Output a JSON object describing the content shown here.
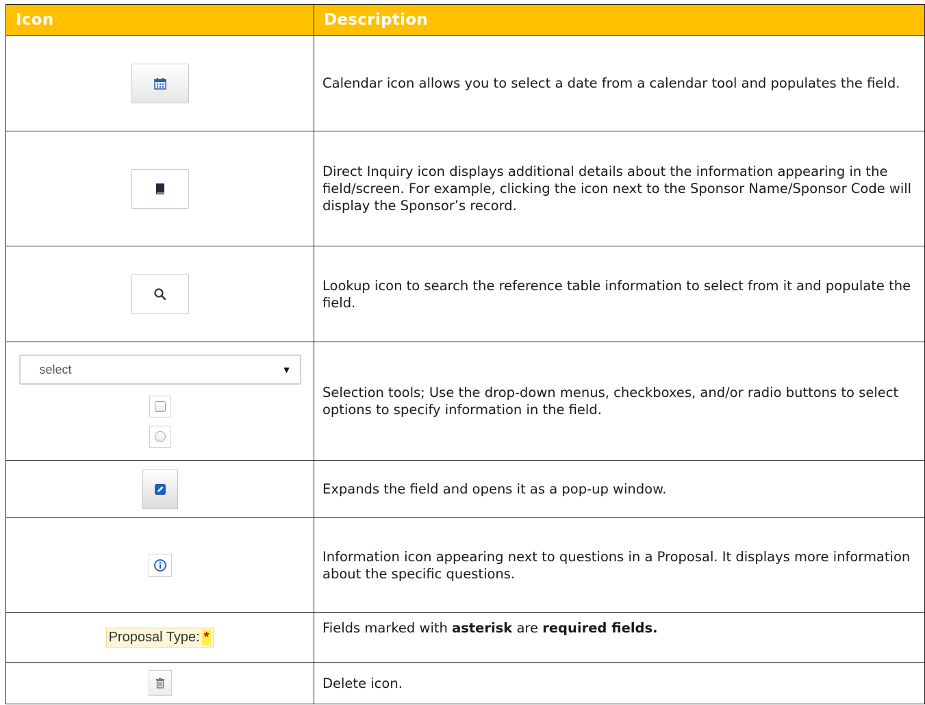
{
  "header": {
    "icon_col": "Icon",
    "description_col": "Description"
  },
  "icons": {
    "calendar": "calendar-icon",
    "direct_inquiry": "book-icon",
    "lookup": "search-icon",
    "expand": "edit-icon",
    "information": "info-icon",
    "delete": "trash-icon"
  },
  "rows": {
    "calendar": {
      "description": "Calendar icon allows you to select a date from a calendar tool and populates the field."
    },
    "direct_inquiry": {
      "description": "Direct Inquiry icon displays additional details about the information appearing in the field/screen. For example, clicking the icon next to the Sponsor Name/Sponsor Code will display the Sponsor’s record."
    },
    "lookup": {
      "description": "Lookup icon to search the reference table information to select from it and populate the field."
    },
    "selection": {
      "select_value": "select",
      "description": "Selection tools; Use the drop-down menus, checkboxes, and/or radio buttons to select options to specify information in the field."
    },
    "expand": {
      "description": "Expands the field and opens it as a pop-up window."
    },
    "information": {
      "description": "Information icon appearing next to questions in a Proposal. It displays more information about the specific questions."
    },
    "required": {
      "label": "Proposal Type:",
      "star": "*",
      "desc_prefix": "Fields marked with ",
      "desc_bold1": "asterisk",
      "desc_middle": " are ",
      "desc_bold2": "required fields."
    },
    "delete": {
      "description": "Delete icon."
    }
  },
  "colors": {
    "header_bg": "#ffc000",
    "header_text": "#ffffff",
    "required_star": "#e00000"
  }
}
